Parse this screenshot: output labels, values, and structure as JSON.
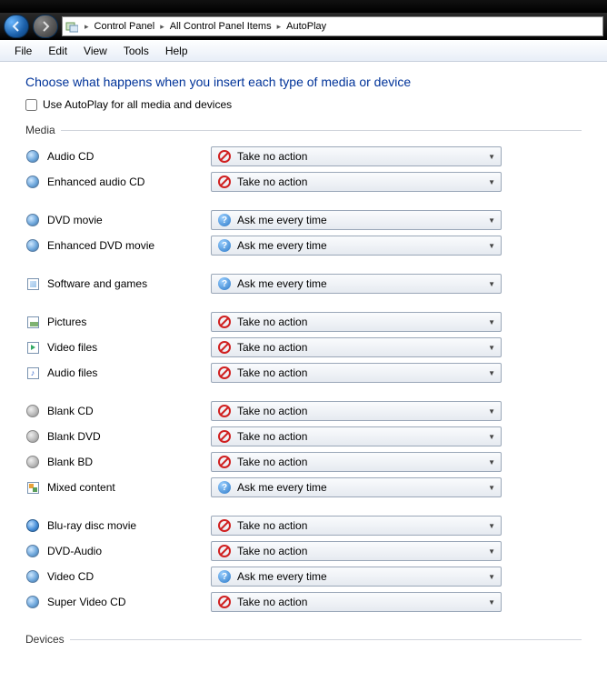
{
  "breadcrumb": {
    "root_icon": "▸",
    "items": [
      "Control Panel",
      "All Control Panel Items",
      "AutoPlay"
    ]
  },
  "menu": {
    "file": "File",
    "edit": "Edit",
    "view": "View",
    "tools": "Tools",
    "help": "Help"
  },
  "heading": "Choose what happens when you insert each type of media or device",
  "checkbox_label": "Use AutoPlay for all media and devices",
  "section_media": "Media",
  "section_devices": "Devices",
  "actions": {
    "no": "Take no action",
    "ask": "Ask me every time"
  },
  "media": [
    {
      "label": "Audio CD",
      "icon": "disc",
      "action": "no",
      "gap": false
    },
    {
      "label": "Enhanced audio CD",
      "icon": "disc",
      "action": "no",
      "gap": true
    },
    {
      "label": "DVD movie",
      "icon": "disc",
      "action": "ask",
      "gap": false
    },
    {
      "label": "Enhanced DVD movie",
      "icon": "disc",
      "action": "ask",
      "gap": true
    },
    {
      "label": "Software and games",
      "icon": "box",
      "action": "ask",
      "gap": true
    },
    {
      "label": "Pictures",
      "icon": "pic",
      "action": "no",
      "gap": false
    },
    {
      "label": "Video files",
      "icon": "vid",
      "action": "no",
      "gap": false
    },
    {
      "label": "Audio files",
      "icon": "aud",
      "action": "no",
      "gap": true
    },
    {
      "label": "Blank CD",
      "icon": "grey",
      "action": "no",
      "gap": false
    },
    {
      "label": "Blank DVD",
      "icon": "grey",
      "action": "no",
      "gap": false
    },
    {
      "label": "Blank BD",
      "icon": "grey",
      "action": "no",
      "gap": false
    },
    {
      "label": "Mixed content",
      "icon": "mixed",
      "action": "ask",
      "gap": true
    },
    {
      "label": "Blu-ray disc movie",
      "icon": "blue",
      "action": "no",
      "gap": false
    },
    {
      "label": "DVD-Audio",
      "icon": "disc",
      "action": "no",
      "gap": false
    },
    {
      "label": "Video CD",
      "icon": "disc",
      "action": "ask",
      "gap": false
    },
    {
      "label": "Super Video CD",
      "icon": "disc",
      "action": "no",
      "gap": true
    }
  ]
}
